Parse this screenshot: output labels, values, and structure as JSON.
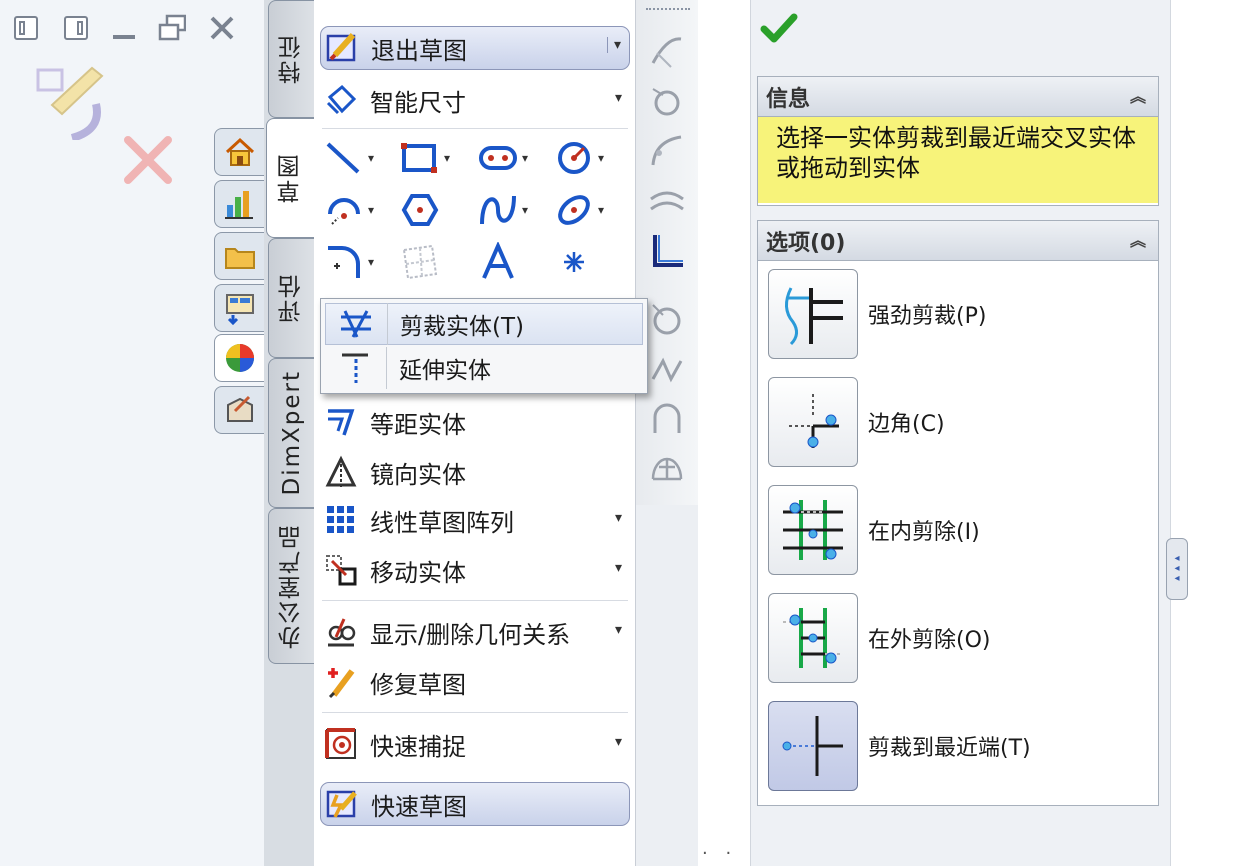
{
  "window": {
    "controls": [
      "restore-left-icon",
      "restore-right-icon",
      "minimize-icon",
      "tile-icon",
      "close-icon"
    ],
    "dots_bottom": ". ."
  },
  "left_tabs": [
    "home-icon",
    "chart-icon",
    "folder-icon",
    "view-icon",
    "appearance-icon",
    "custom-icon"
  ],
  "command_tabs": {
    "feature": "特征",
    "sketch": "草图",
    "evaluate": "评估",
    "dimxpert": "DimXpert",
    "office": "办公室产品"
  },
  "sketch": {
    "exit_sketch": "退出草图",
    "smart_dimension": "智能尺寸",
    "offset_entities": "等距实体",
    "mirror_entities": "镜向实体",
    "linear_pattern": "线性草图阵列",
    "move_entities": "移动实体",
    "display_relations": "显示/删除几何关系",
    "repair_sketch": "修复草图",
    "quick_snaps": "快速捕捉",
    "rapid_sketch": "快速草图"
  },
  "popup": {
    "trim": "剪裁实体(T)",
    "extend": "延伸实体"
  },
  "property": {
    "info_title": "信息",
    "info_message": "选择一实体剪裁到最近端交叉实体或拖动到实体",
    "options_title": "选项(0)",
    "options": [
      {
        "label": "强劲剪裁(P)",
        "icon": "power-trim-icon"
      },
      {
        "label": "边角(C)",
        "icon": "corner-icon"
      },
      {
        "label": "在内剪除(I)",
        "icon": "trim-inside-icon"
      },
      {
        "label": "在外剪除(O)",
        "icon": "trim-outside-icon"
      },
      {
        "label": "剪裁到最近端(T)",
        "icon": "trim-to-closest-icon",
        "selected": true
      }
    ]
  },
  "colors": {
    "accent_blue": "#1a56c8",
    "info_yellow": "#f7f37a",
    "ok_green": "#2aa02a",
    "trim_green": "#18a848"
  }
}
